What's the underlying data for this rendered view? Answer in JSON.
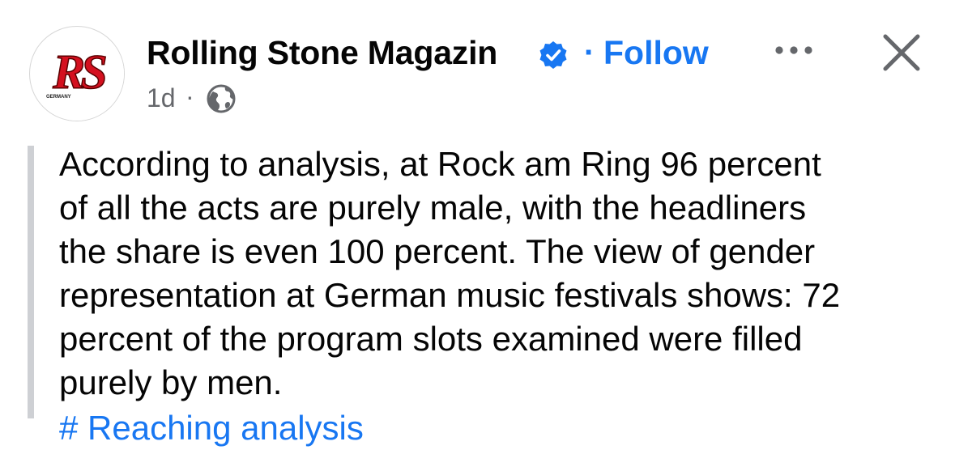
{
  "post": {
    "page_name": "Rolling Stone Magazin",
    "separator": "·",
    "follow_label": "Follow",
    "time": "1d",
    "meta_separator": "·",
    "body_lines": [
      "According to analysis, at Rock am Ring 96 percent",
      "of all the acts are purely male, with the headliners",
      "the share is even 100 percent. The view of gender",
      "representation at German music festivals shows: 72",
      "percent of the program slots examined were filled",
      "purely by men."
    ],
    "cut_off_text": "# Reaching analysis"
  },
  "avatar": {
    "logo_text": "RS",
    "logo_subtext": "GERMANY"
  },
  "icons": {
    "verified": "verified-badge-icon",
    "globe": "globe-icon",
    "more": "more-options-icon",
    "close": "close-icon"
  },
  "colors": {
    "accent": "#1877f2",
    "text": "#050505",
    "secondary": "#65676b",
    "logo_red": "#d4101f",
    "quote_bar": "#ced0d4"
  }
}
